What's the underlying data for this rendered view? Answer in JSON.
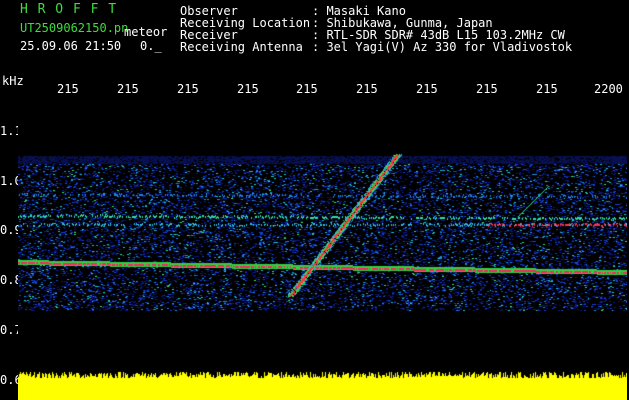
{
  "header": {
    "app_title": "H R O F F T",
    "filename": "UT2509062150.pn",
    "mode": "meteor",
    "datetime": "25.09.06 21:50",
    "counter": "0._",
    "labels": [
      "Observer",
      "Receiving Location",
      "Receiver",
      "Receiving Antenna"
    ],
    "values": [
      ": Masaki Kano",
      ": Shibukawa, Gunma, Japan",
      ": RTL-SDR SDR# 43dB L15 103.2MHz CW",
      ": 3el Yagi(V) Az 330 for Vladivostok"
    ]
  },
  "time_axis": {
    "ticks": [
      "215",
      "215",
      "215",
      "215",
      "215",
      "215",
      "215",
      "215",
      "215",
      "2200"
    ]
  },
  "freq_axis": {
    "unit": "kHz",
    "ticks": [
      "1.1",
      "1.0",
      "0.9",
      "0.8",
      "0.7",
      "0.6"
    ]
  },
  "colors": {
    "header_green": "#3fdc3f",
    "background": "#000000",
    "level_bar": "#ffff00",
    "noise_blue": "#1030c0"
  }
}
